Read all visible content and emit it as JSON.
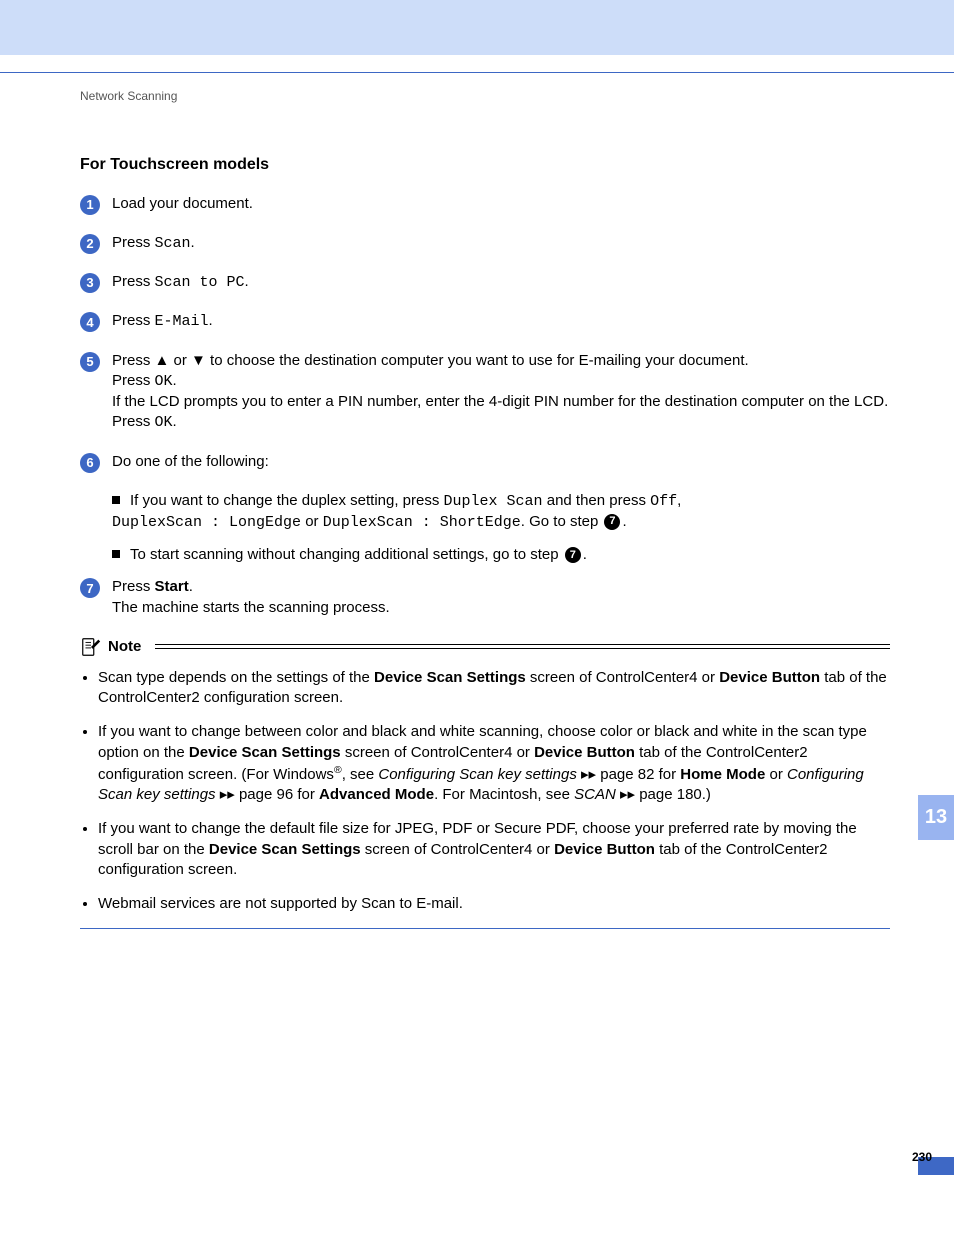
{
  "header": {
    "running_head": "Network Scanning"
  },
  "section": {
    "title": "For Touchscreen models"
  },
  "steps": {
    "s1": "Load your document.",
    "s2_pre": "Press ",
    "s2_mono": "Scan",
    "s2_post": ".",
    "s3_pre": "Press ",
    "s3_mono": "Scan to PC",
    "s3_post": ".",
    "s4_pre": "Press ",
    "s4_mono": "E-Mail",
    "s4_post": ".",
    "s5_a": "Press ▲ or ▼ to choose the destination computer you want to use for E-mailing your document.",
    "s5_b_pre": "Press ",
    "s5_b_mono": "OK",
    "s5_b_post": ".",
    "s5_c": "If the LCD prompts you to enter a PIN number, enter the 4-digit PIN number for the destination computer on the LCD.",
    "s5_d_pre": "Press ",
    "s5_d_mono": "OK",
    "s5_d_post": ".",
    "s6_intro": "Do one of the following:",
    "s6_a1": "If you want to change the duplex setting, press ",
    "s6_a1_m1": "Duplex Scan",
    "s6_a1_mid1": " and then press ",
    "s6_a1_m2": "Off",
    "s6_a1_mid2": ", ",
    "s6_a1_m3": "DuplexScan : LongEdge",
    "s6_a1_mid3": " or ",
    "s6_a1_m4": "DuplexScan : ShortEdge",
    "s6_a1_mid4": ". Go to step ",
    "s6_a1_ref": "7",
    "s6_a1_end": ".",
    "s6_b": "To start scanning without changing additional settings, go to step ",
    "s6_b_ref": "7",
    "s6_b_end": ".",
    "s7_a_pre": "Press ",
    "s7_a_b": "Start",
    "s7_a_post": ".",
    "s7_b": "The machine starts the scanning process."
  },
  "note": {
    "label": "Note",
    "n1_a": "Scan type depends on the settings of the ",
    "n1_b": "Device Scan Settings",
    "n1_c": " screen of ControlCenter4 or ",
    "n1_d": "Device Button",
    "n1_e": " tab of the ControlCenter2 configuration screen.",
    "n2_a": "If you want to change between color and black and white scanning, choose color or black and white in the scan type option on the ",
    "n2_b": "Device Scan Settings",
    "n2_c": " screen of ControlCenter4 or ",
    "n2_d": "Device Button",
    "n2_e": " tab of the ControlCenter2 configuration screen. (For Windows",
    "n2_sup": "®",
    "n2_f": ", see ",
    "n2_g": "Configuring Scan key settings",
    "n2_h": " ▸▸ page 82 for ",
    "n2_i": "Home Mode",
    "n2_j": " or ",
    "n2_k": "Configuring Scan key settings",
    "n2_l": " ▸▸ page 96 for ",
    "n2_m": "Advanced Mode",
    "n2_n": ". For Macintosh, see ",
    "n2_o": "SCAN",
    "n2_p": " ▸▸ page 180.)",
    "n3_a": "If you want to change the default file size for JPEG, PDF or Secure PDF, choose your preferred rate by moving the scroll bar on the ",
    "n3_b": "Device Scan Settings",
    "n3_c": " screen of ControlCenter4 or ",
    "n3_d": "Device Button",
    "n3_e": " tab of the ControlCenter2 configuration screen.",
    "n4": "Webmail services are not supported by Scan to E-mail."
  },
  "footer": {
    "page": "230",
    "chapter_tab": "13"
  }
}
